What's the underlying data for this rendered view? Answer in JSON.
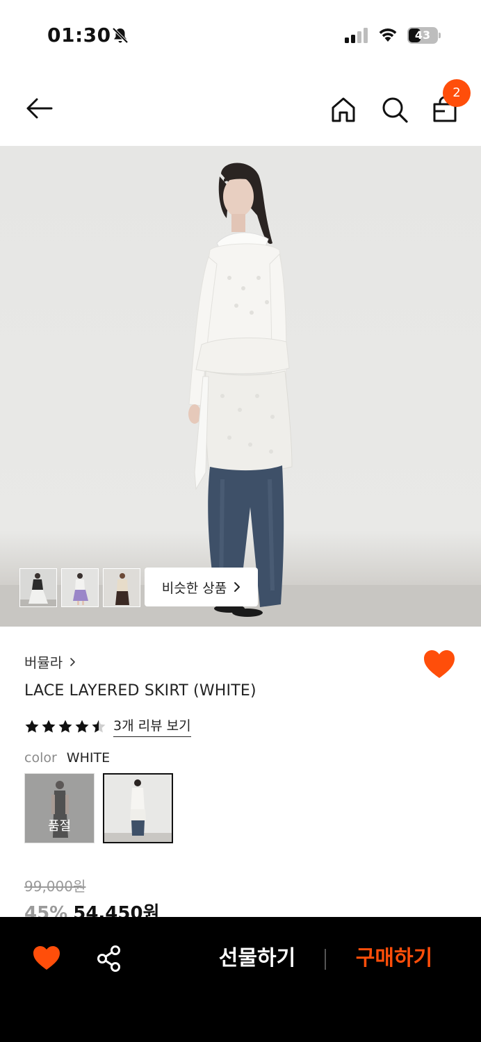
{
  "status_bar": {
    "time": "01:30",
    "battery": "43",
    "battery_level": 0.43
  },
  "nav": {
    "cart_count": "2"
  },
  "gallery": {
    "similar_label": "비슷한 상품"
  },
  "product": {
    "brand": "버뮬라",
    "title": "LACE LAYERED SKIRT (WHITE)",
    "rating": 4.5,
    "review_link": "3개 리뷰 보기",
    "color_label": "color",
    "color_value": "WHITE",
    "swatch_soldout": "품절",
    "price_original": "99,000원",
    "discount": "45%",
    "price_final": "54,450원"
  },
  "bottom_bar": {
    "gift_label": "선물하기",
    "buy_label": "구매하기"
  },
  "colors": {
    "accent": "#ff4e0a",
    "bar": "#000000"
  }
}
